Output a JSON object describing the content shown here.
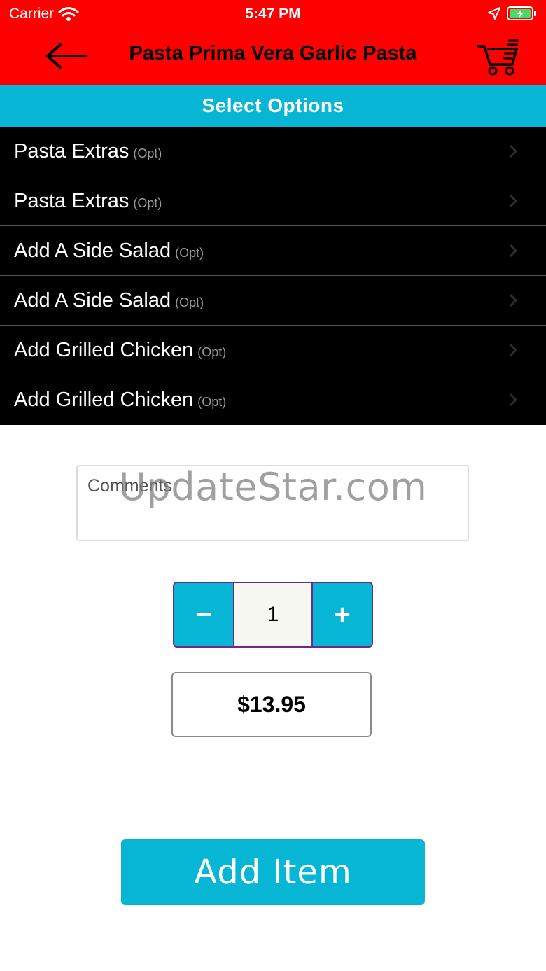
{
  "status_bar": {
    "carrier": "Carrier",
    "time": "5:47 PM"
  },
  "header": {
    "title": "Pasta Prima Vera Garlic Pasta",
    "back_icon": "back-arrow-icon",
    "cart_icon": "cart-icon"
  },
  "options_header": "Select Options",
  "options": [
    {
      "label": "Pasta Extras",
      "tag": "(Opt)"
    },
    {
      "label": "Pasta Extras",
      "tag": "(Opt)"
    },
    {
      "label": "Add A Side Salad",
      "tag": "(Opt)"
    },
    {
      "label": "Add A Side Salad",
      "tag": "(Opt)"
    },
    {
      "label": "Add Grilled Chicken",
      "tag": "(Opt)"
    },
    {
      "label": "Add Grilled Chicken",
      "tag": "(Opt)"
    }
  ],
  "comments": {
    "placeholder": "Comments"
  },
  "watermark": "UpdateStar.com",
  "quantity": {
    "minus": "−",
    "value": "1",
    "plus": "+"
  },
  "price": "$13.95",
  "add_button": "Add Item",
  "colors": {
    "header": "#ff0000",
    "accent": "#06b6d4",
    "options_bg": "#000000",
    "stepper_border": "#6b2a8c"
  }
}
